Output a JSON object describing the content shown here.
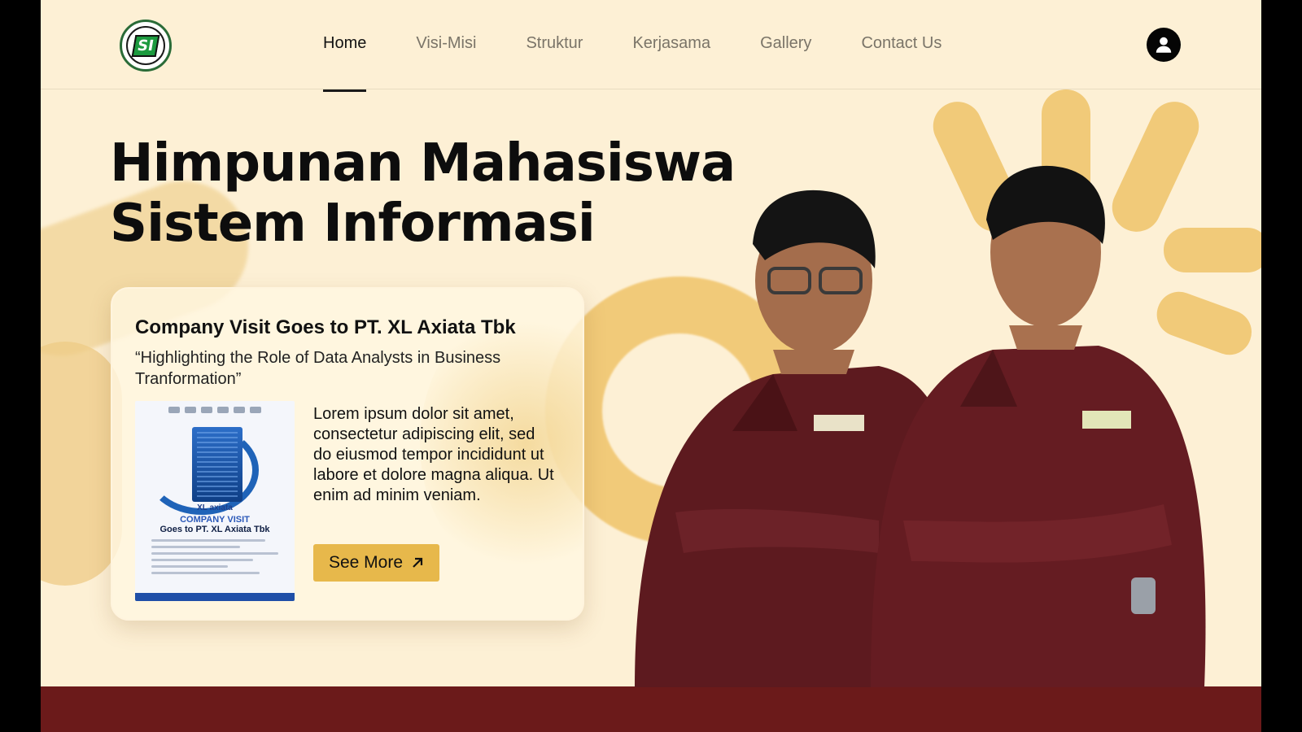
{
  "header": {
    "logo_alt": "SI logo",
    "logo_text": "SI",
    "nav": [
      {
        "label": "Home",
        "active": true
      },
      {
        "label": "Visi-Misi",
        "active": false
      },
      {
        "label": "Struktur",
        "active": false
      },
      {
        "label": "Kerjasama",
        "active": false
      },
      {
        "label": "Gallery",
        "active": false
      },
      {
        "label": "Contact Us",
        "active": false
      }
    ],
    "user_icon": "user-icon"
  },
  "hero": {
    "title_line1": "Himpunan Mahasiswa",
    "title_line2": "Sistem Informasi"
  },
  "card": {
    "title": "Company Visit Goes to PT. XL Axiata Tbk",
    "subtitle": "“Highlighting the Role of Data Analysts in Business Tranformation”",
    "body": "Lorem ipsum dolor sit amet, consectetur adipiscing elit, sed do eiusmod tempor incididunt ut labore et dolore magna aliqua. Ut enim ad minim veniam.",
    "button_label": "See More",
    "button_icon": "arrow-up-right-icon",
    "poster": {
      "brand": "XL axiata",
      "heading1": "COMPANY VISIT",
      "heading2": "Goes to PT. XL Axiata Tbk"
    }
  },
  "colors": {
    "background": "#fdf0d5",
    "accent": "#e7b84b",
    "footer": "#6b1a1a",
    "text": "#0d0d0d"
  }
}
